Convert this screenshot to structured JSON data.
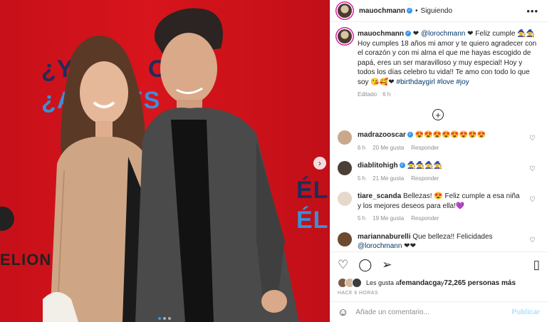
{
  "post": {
    "username": "mauochmann",
    "follow_status": "Siguiendo",
    "more": "•••",
    "photo_text": {
      "line1": "¿Y",
      "line1b": "O L",
      "line2": "¿A",
      "line2b": "ES",
      "right1": "ÉL?",
      "right2": "ÉL?",
      "left_word": "ELION"
    }
  },
  "caption": {
    "username": "mauochmann",
    "parts": [
      "❤ ",
      "@lorochmann",
      " ❤ Feliz cumple 🧙🧙 Hoy cumples 18 años mi amor y te quiero agradecer con el corazón y con mi alma el que me hayas escogido de papá, eres un ser maravilloso y muy especial! Hoy y todos los días celebro tu vida!! Te amo con todo lo que soy 😘🥰❤ ",
      "#birthdaygirl #love #joy"
    ],
    "edited": "Editado",
    "time": "6 h"
  },
  "load_more": "+",
  "comments": [
    {
      "username": "madrazooscar",
      "text": "😍😍😍😍😍😍😍😍",
      "time": "6 h",
      "likes": "20 Me gusta",
      "reply": "Responder",
      "avatar_color": "#c9a98d"
    },
    {
      "username": "diablitohigh",
      "text": "🧙🧙🧙🧙",
      "time": "5 h",
      "likes": "21 Me gusta",
      "reply": "Responder",
      "avatar_color": "#4b4038"
    },
    {
      "username": "tiare_scanda",
      "text": "Bellezas! 😍 Feliz cumple a esa niña y los mejores deseos para ella!💜",
      "time": "5 h",
      "likes": "19 Me gusta",
      "reply": "Responder",
      "avatar_color": "#e7d8cc"
    },
    {
      "username": "mariannaburelli",
      "text_pre": "Que belleza!! Felicidades ",
      "mention": "@lorochmann",
      "text_post": " ❤❤",
      "avatar_color": "#6b4a2f"
    }
  ],
  "actions": {
    "like": "♡",
    "comment": "◯",
    "share": "➢",
    "save": "▯"
  },
  "likes_line": {
    "prefix": "Les gusta a ",
    "user": "femandacga",
    "middle": " y ",
    "count": "72,265 personas más"
  },
  "posted_time": "HACE 6 HORAS",
  "add_comment": {
    "emoji": "☺",
    "placeholder": "Añade un comentario...",
    "publish": "Publicar"
  },
  "colors": {
    "accent_blue": "#3897f0",
    "link": "#00376b",
    "photo_red": "#d8141c",
    "muted": "#8e8e8e"
  }
}
